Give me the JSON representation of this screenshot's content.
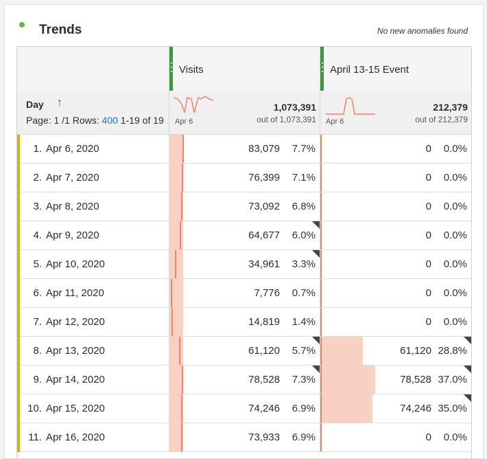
{
  "panel": {
    "title": "Trends",
    "anomaly_text": "No new anomalies found",
    "status_color": "#6db33f"
  },
  "colors": {
    "accent_green": "#2e9e3e",
    "row_flag": "#dab021",
    "bar_fill": "#f8d1c3",
    "bar_line": "#e8886a",
    "link": "#1473e6"
  },
  "table": {
    "dimension_label": "Day",
    "sort_icon": "arrow-up-icon",
    "pager": {
      "page_label": "Page: 1 /1",
      "rows_label": "Rows:",
      "rows_value": "400",
      "range": "1-19 of 19"
    },
    "columns": [
      {
        "label": "Visits",
        "total": "1,073,391",
        "out_of": "out of 1,073,391",
        "spark_date": "Apr 6"
      },
      {
        "label": "April 13-15 Event",
        "total": "212,379",
        "out_of": "out of 212,379",
        "spark_date": "Apr 6"
      }
    ],
    "rows": [
      {
        "num": "1.",
        "day": "Apr 6, 2020",
        "visits": "83,079",
        "visits_pct": "7.7%",
        "visits_frac": 0.077,
        "visits_flag": false,
        "event": "0",
        "event_pct": "0.0%",
        "event_frac": 0,
        "event_flag": false
      },
      {
        "num": "2.",
        "day": "Apr 7, 2020",
        "visits": "76,399",
        "visits_pct": "7.1%",
        "visits_frac": 0.071,
        "visits_flag": false,
        "event": "0",
        "event_pct": "0.0%",
        "event_frac": 0,
        "event_flag": false
      },
      {
        "num": "3.",
        "day": "Apr 8, 2020",
        "visits": "73,092",
        "visits_pct": "6.8%",
        "visits_frac": 0.068,
        "visits_flag": false,
        "event": "0",
        "event_pct": "0.0%",
        "event_frac": 0,
        "event_flag": false
      },
      {
        "num": "4.",
        "day": "Apr 9, 2020",
        "visits": "64,677",
        "visits_pct": "6.0%",
        "visits_frac": 0.06,
        "visits_flag": true,
        "event": "0",
        "event_pct": "0.0%",
        "event_frac": 0,
        "event_flag": false
      },
      {
        "num": "5.",
        "day": "Apr 10, 2020",
        "visits": "34,961",
        "visits_pct": "3.3%",
        "visits_frac": 0.033,
        "visits_flag": true,
        "event": "0",
        "event_pct": "0.0%",
        "event_frac": 0,
        "event_flag": false
      },
      {
        "num": "6.",
        "day": "Apr 11, 2020",
        "visits": "7,776",
        "visits_pct": "0.7%",
        "visits_frac": 0.007,
        "visits_flag": false,
        "event": "0",
        "event_pct": "0.0%",
        "event_frac": 0,
        "event_flag": false
      },
      {
        "num": "7.",
        "day": "Apr 12, 2020",
        "visits": "14,819",
        "visits_pct": "1.4%",
        "visits_frac": 0.014,
        "visits_flag": false,
        "event": "0",
        "event_pct": "0.0%",
        "event_frac": 0,
        "event_flag": false
      },
      {
        "num": "8.",
        "day": "Apr 13, 2020",
        "visits": "61,120",
        "visits_pct": "5.7%",
        "visits_frac": 0.057,
        "visits_flag": true,
        "event": "61,120",
        "event_pct": "28.8%",
        "event_frac": 0.288,
        "event_flag": true
      },
      {
        "num": "9.",
        "day": "Apr 14, 2020",
        "visits": "78,528",
        "visits_pct": "7.3%",
        "visits_frac": 0.073,
        "visits_flag": true,
        "event": "78,528",
        "event_pct": "37.0%",
        "event_frac": 0.37,
        "event_flag": true
      },
      {
        "num": "10.",
        "day": "Apr 15, 2020",
        "visits": "74,246",
        "visits_pct": "6.9%",
        "visits_frac": 0.069,
        "visits_flag": false,
        "event": "74,246",
        "event_pct": "35.0%",
        "event_frac": 0.35,
        "event_flag": true
      },
      {
        "num": "11.",
        "day": "Apr 16, 2020",
        "visits": "73,933",
        "visits_pct": "6.9%",
        "visits_frac": 0.069,
        "visits_flag": false,
        "event": "0",
        "event_pct": "0.0%",
        "event_frac": 0,
        "event_flag": false
      }
    ]
  }
}
